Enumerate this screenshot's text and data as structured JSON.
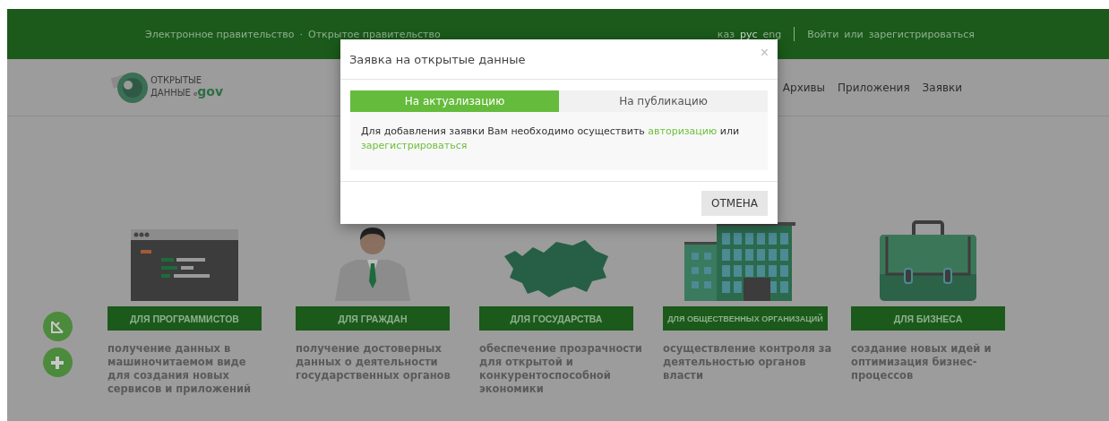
{
  "top_bar": {
    "links": [
      "Электронное правительство",
      "Открытое правительство"
    ],
    "separator": "·",
    "languages": [
      {
        "label": "каз",
        "selected": false
      },
      {
        "label": "рус",
        "selected": true
      },
      {
        "label": "eng",
        "selected": false
      }
    ],
    "login": "Войти",
    "or": "или",
    "register": "зарегистрироваться"
  },
  "logo": {
    "line_1": "ОТКРЫТЫЕ",
    "line_2": "ДАННЫЕ",
    "mark_small": "e",
    "mark": "gov"
  },
  "nav": {
    "items": [
      "Архивы",
      "Приложения",
      "Заявки"
    ]
  },
  "cards": [
    {
      "kind": "code",
      "label": "ДЛЯ ПРОГРАММИСТОВ",
      "text": "получение данных в машиночитаемом виде\nдля создания новых сервисов и приложений"
    },
    {
      "kind": "person",
      "label": "ДЛЯ ГРАЖДАН",
      "text": "получение достоверных данных о деятельности государственных органов"
    },
    {
      "kind": "map",
      "label": "ДЛЯ ГОСУДАРСТВА",
      "text": "обеспечение прозрачности для открытой и конкурентоспособной экономики"
    },
    {
      "kind": "building",
      "label": "ДЛЯ ОБЩЕСТВЕННЫХ ОРГАНИЗАЦИЙ",
      "text": "осуществление контроля за деятельностью органов власти"
    },
    {
      "kind": "briefcase",
      "label": "ДЛЯ БИЗНЕСА",
      "text": "создание новых идей и оптимизация бизнес-процессов"
    }
  ],
  "modal": {
    "title": "Заявка на открытые данные",
    "close": "×",
    "tabs": [
      {
        "label": "На актуализацию",
        "selected": true
      },
      {
        "label": "На публикацию",
        "selected": false
      }
    ],
    "message": {
      "before": "Для добавления заявки Вам необходимо осуществить",
      "link_1": "авторизацию",
      "middle": "или",
      "link_2": "зарегистрироваться"
    },
    "cancel": "ОТМЕНА"
  }
}
